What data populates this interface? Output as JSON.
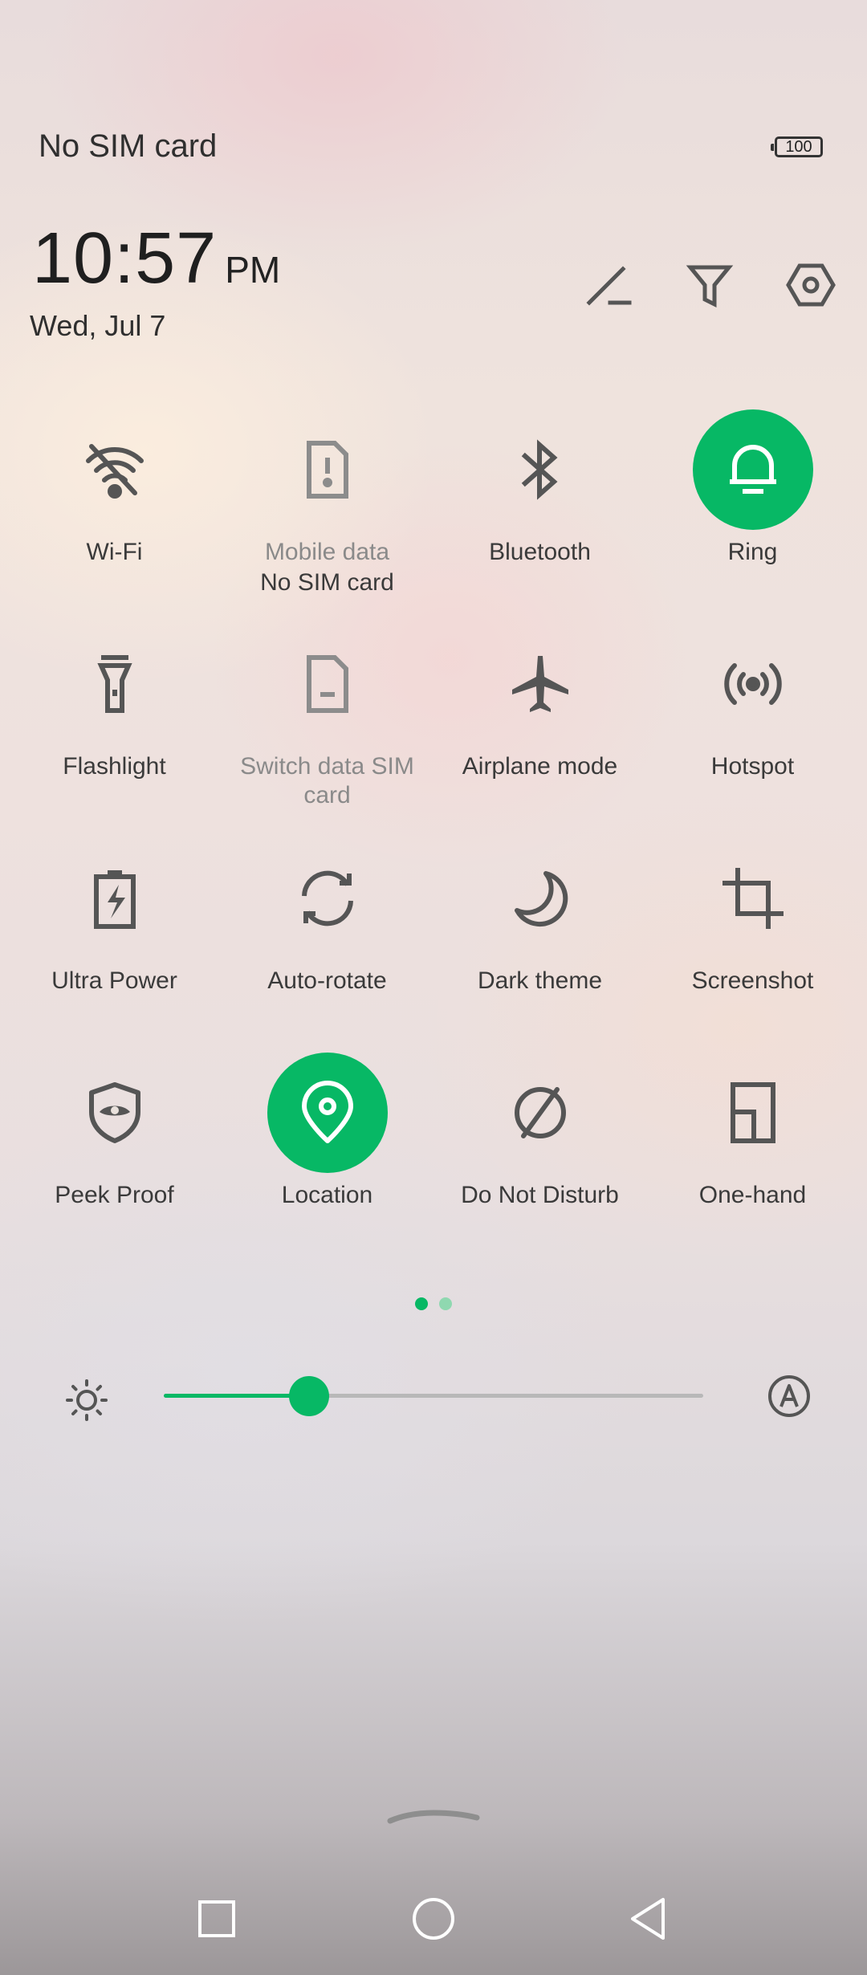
{
  "status_bar": {
    "carrier": "No SIM card",
    "battery_level": "100"
  },
  "clock": {
    "time": "10:57",
    "ampm": "PM",
    "date": "Wed, Jul 7"
  },
  "header_actions": [
    {
      "icon": "edit-icon"
    },
    {
      "icon": "filter-icon"
    },
    {
      "icon": "settings-icon"
    }
  ],
  "tiles": [
    {
      "label": "Wi-Fi",
      "icon": "wifi-off-icon",
      "active": false
    },
    {
      "label": "Mobile data",
      "sub": "No SIM card",
      "icon": "sim-alert-icon",
      "active": false,
      "dim": true
    },
    {
      "label": "Bluetooth",
      "icon": "bluetooth-icon",
      "active": false
    },
    {
      "label": "Ring",
      "icon": "bell-icon",
      "active": true
    },
    {
      "label": "Flashlight",
      "icon": "flashlight-icon",
      "active": false
    },
    {
      "label": "Switch data SIM card",
      "icon": "sim-card-icon",
      "active": false,
      "dim": true
    },
    {
      "label": "Airplane mode",
      "icon": "airplane-icon",
      "active": false
    },
    {
      "label": "Hotspot",
      "icon": "hotspot-icon",
      "active": false
    },
    {
      "label": "Ultra Power",
      "icon": "battery-bolt-icon",
      "active": false
    },
    {
      "label": "Auto-rotate",
      "icon": "auto-rotate-icon",
      "active": false
    },
    {
      "label": "Dark theme",
      "icon": "moon-icon",
      "active": false
    },
    {
      "label": "Screenshot",
      "icon": "crop-icon",
      "active": false
    },
    {
      "label": "Peek Proof",
      "icon": "shield-eye-icon",
      "active": false
    },
    {
      "label": "Location",
      "icon": "location-pin-icon",
      "active": true
    },
    {
      "label": "Do Not Disturb",
      "icon": "do-not-disturb-icon",
      "active": false
    },
    {
      "label": "One-hand",
      "icon": "one-hand-icon",
      "active": false
    }
  ],
  "pager": {
    "pages": 2,
    "current": 1
  },
  "brightness": {
    "level": 0.27
  },
  "nav_bar": [
    {
      "icon": "recents-square-icon"
    },
    {
      "icon": "home-circle-icon"
    },
    {
      "icon": "back-triangle-icon"
    }
  ],
  "colors": {
    "accent": "#07b865",
    "accent_light": "#8fd8b0",
    "icon": "#555555",
    "icon_dim": "#8c8c8c"
  }
}
